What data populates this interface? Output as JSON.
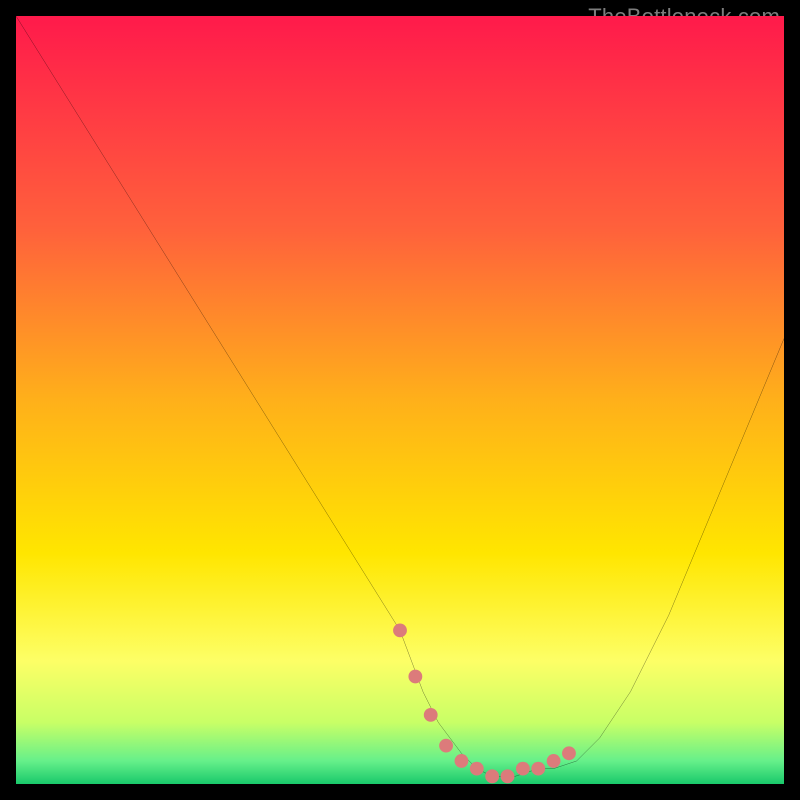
{
  "watermark": "TheBottleneck.com",
  "chart_data": {
    "type": "line",
    "title": "",
    "xlabel": "",
    "ylabel": "",
    "xlim": [
      0,
      100
    ],
    "ylim": [
      0,
      100
    ],
    "grid": false,
    "series": [
      {
        "name": "curve",
        "color": "#000000",
        "x": [
          0,
          5,
          10,
          15,
          20,
          25,
          30,
          35,
          40,
          45,
          50,
          53,
          55,
          58,
          60,
          62,
          65,
          68,
          70,
          73,
          76,
          80,
          85,
          90,
          95,
          100
        ],
        "y": [
          100,
          92,
          84,
          76,
          68,
          60,
          52,
          44,
          36,
          28,
          20,
          12,
          8,
          4,
          2,
          1,
          1,
          2,
          2,
          3,
          6,
          12,
          22,
          34,
          46,
          58
        ]
      },
      {
        "name": "highlight",
        "color": "#dc7b7b",
        "style": "dotted",
        "x": [
          50,
          52,
          54,
          56,
          58,
          60,
          62,
          64,
          66,
          68,
          70,
          72
        ],
        "y": [
          20,
          14,
          9,
          5,
          3,
          2,
          1,
          1,
          2,
          2,
          3,
          4
        ]
      }
    ],
    "background_gradient": {
      "stops": [
        {
          "pos": 0.0,
          "color": "#ff1a4b"
        },
        {
          "pos": 0.28,
          "color": "#ff623b"
        },
        {
          "pos": 0.5,
          "color": "#ffb01a"
        },
        {
          "pos": 0.7,
          "color": "#ffe600"
        },
        {
          "pos": 0.84,
          "color": "#fdff66"
        },
        {
          "pos": 0.92,
          "color": "#c8ff66"
        },
        {
          "pos": 0.97,
          "color": "#66f08a"
        },
        {
          "pos": 1.0,
          "color": "#19c96b"
        }
      ]
    }
  }
}
